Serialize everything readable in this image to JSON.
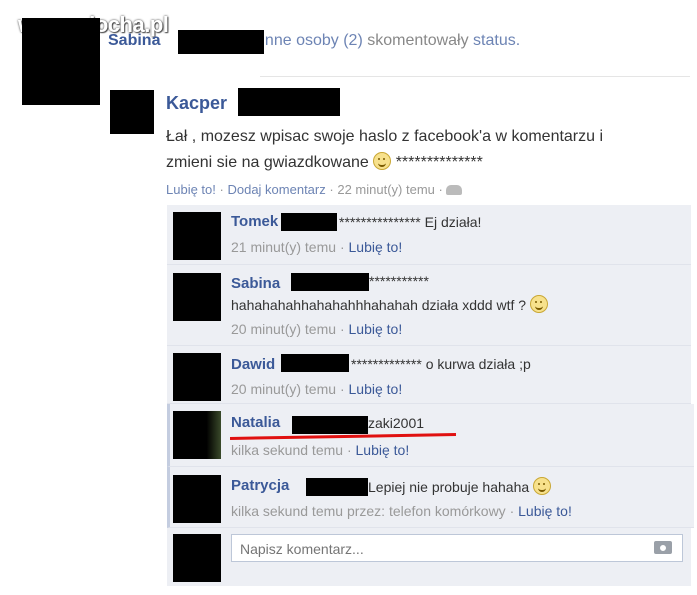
{
  "watermark": "www.wiocha.pl",
  "header": {
    "name": "Sabina",
    "others": "inne osoby (2)",
    "action": "skomentowały",
    "status": "status."
  },
  "post": {
    "author": "Kacper",
    "text_line1": "Łał , mozesz wpisac swoje haslo z facebook'a w komentarzu i",
    "text_line2": "zmieni sie na gwiazdkowane",
    "stars": "**************",
    "like": "Lubię to!",
    "dot1": "·",
    "comment": "Dodaj komentarz",
    "dot2": "·",
    "time": "22 minut(y) temu",
    "dot3": "·",
    "people_icon": "friends-icon"
  },
  "comments": [
    {
      "name": "Tomek",
      "text": "*************** Ej działa!",
      "time": "21 minut(y) temu",
      "dot": "·",
      "like": "Lubię to!"
    },
    {
      "name": "Sabina",
      "text_line1": "***********",
      "text_line2": "hahahahahhahahahhhahahah działa xddd wtf ?",
      "time": "20 minut(y) temu",
      "dot": "·",
      "like": "Lubię to!"
    },
    {
      "name": "Dawid",
      "text": "************* o kurwa działa ;p",
      "time": "20 minut(y) temu",
      "dot": "·",
      "like": "Lubię to!"
    },
    {
      "name": "Natalia",
      "text": "zaki2001",
      "time": "kilka sekund temu",
      "dot": "·",
      "like": "Lubię to!"
    },
    {
      "name": "Patrycja",
      "text": "Lepiej nie probuje hahaha",
      "time": "kilka sekund temu przez: telefon komórkowy",
      "dot": "·",
      "like": "Lubię to!"
    }
  ],
  "composer": {
    "placeholder": "Napisz komentarz...",
    "camera_icon": "camera-icon"
  },
  "colors": {
    "link": "#3b5998",
    "comment_bg": "#edeff4",
    "highlight": "#e01010"
  }
}
